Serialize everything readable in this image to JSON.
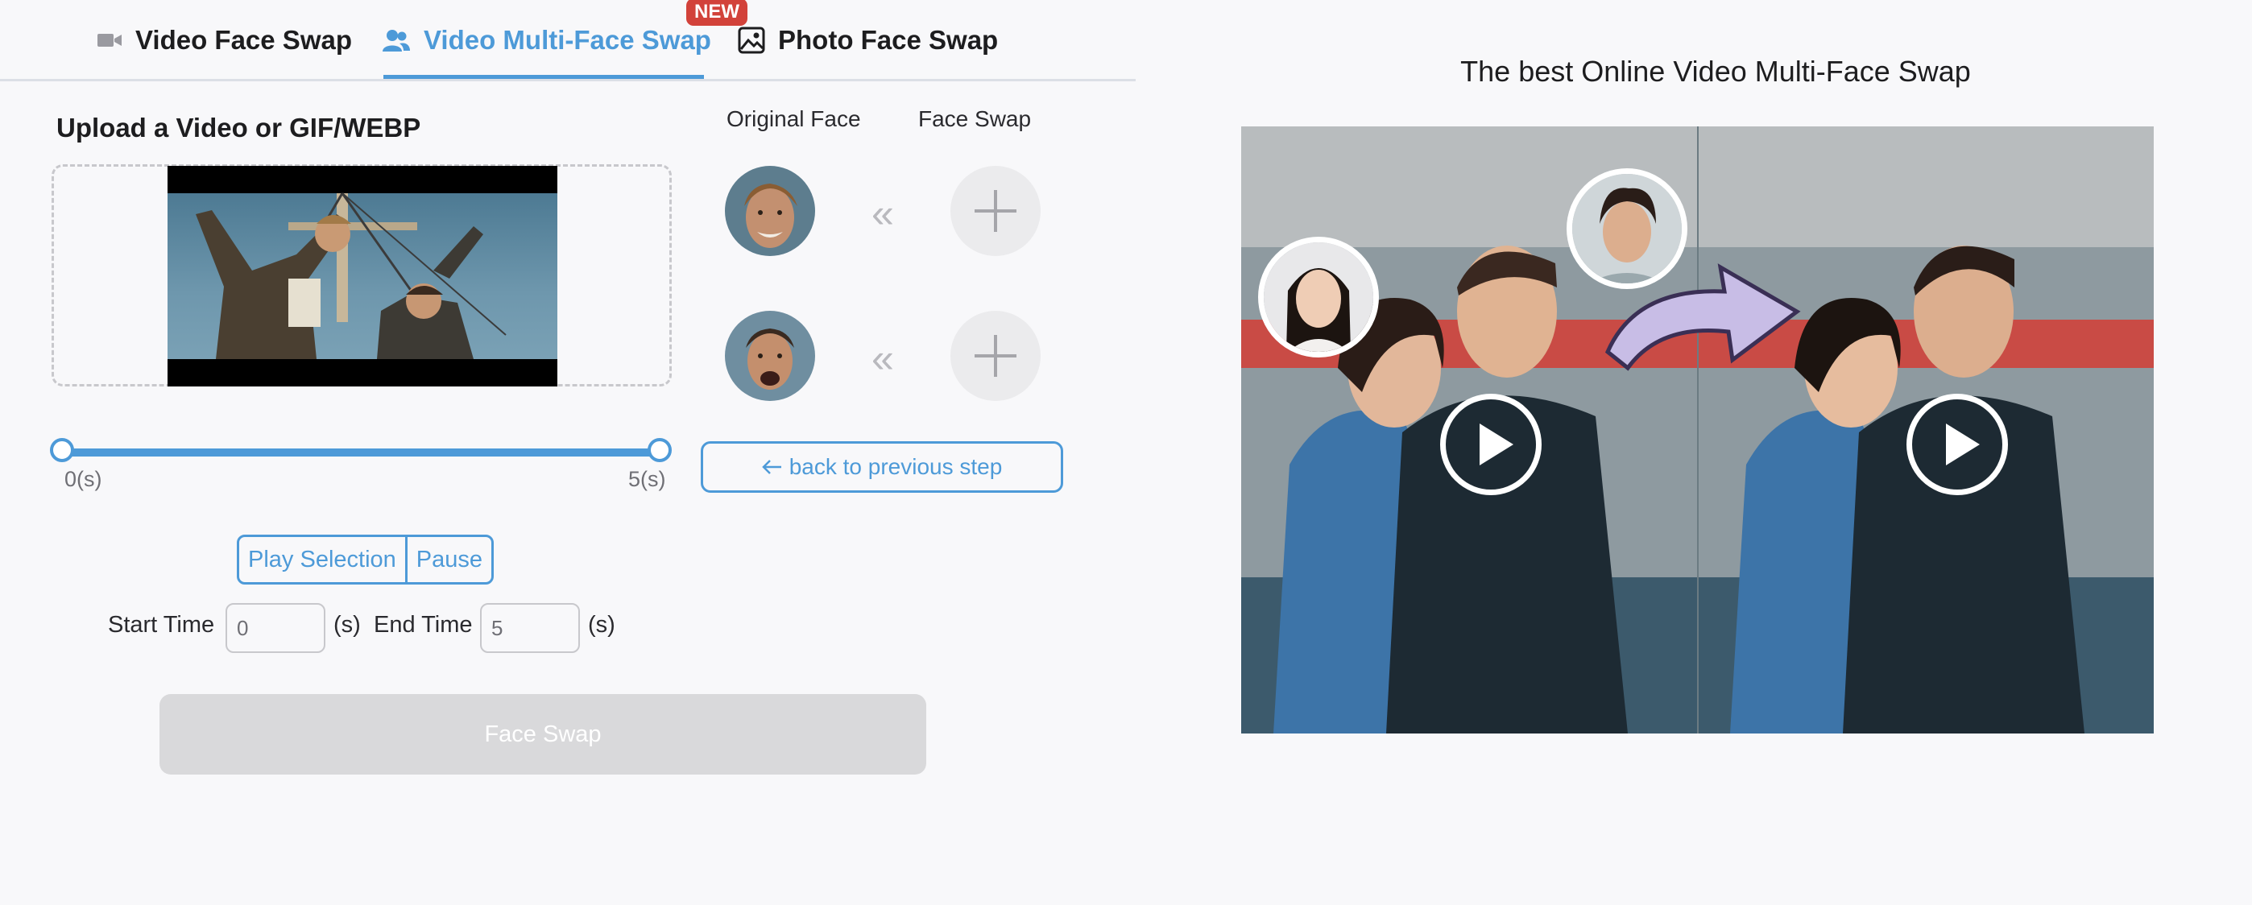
{
  "tabs": [
    {
      "label": "Video Face Swap",
      "icon": "video-camera-icon",
      "active": false
    },
    {
      "label": "Video Multi-Face Swap",
      "icon": "users-icon",
      "active": true,
      "badge": "NEW"
    },
    {
      "label": "Photo Face Swap",
      "icon": "image-icon",
      "active": false
    }
  ],
  "upload": {
    "title": "Upload a Video or GIF/WEBP"
  },
  "slider": {
    "start_label": "0(s)",
    "end_label": "5(s)",
    "selected_range": [
      0,
      5
    ]
  },
  "faces": {
    "original_title": "Original Face",
    "swap_title": "Face Swap",
    "arrow_glyph": "«"
  },
  "back_button": {
    "label": "back to previous step",
    "icon": "arrow-left-icon"
  },
  "controls": {
    "play_label": "Play Selection",
    "pause_label": "Pause"
  },
  "time": {
    "start_label": "Start Time",
    "start_value": "0",
    "unit": "(s)",
    "end_label": "End Time",
    "end_value": "5"
  },
  "swap_button": {
    "label": "Face Swap"
  },
  "preview": {
    "title": "The best Online Video Multi-Face Swap"
  },
  "colors": {
    "accent": "#4d9ad8",
    "badge": "#d2423a",
    "disabled": "#d9d9db"
  }
}
